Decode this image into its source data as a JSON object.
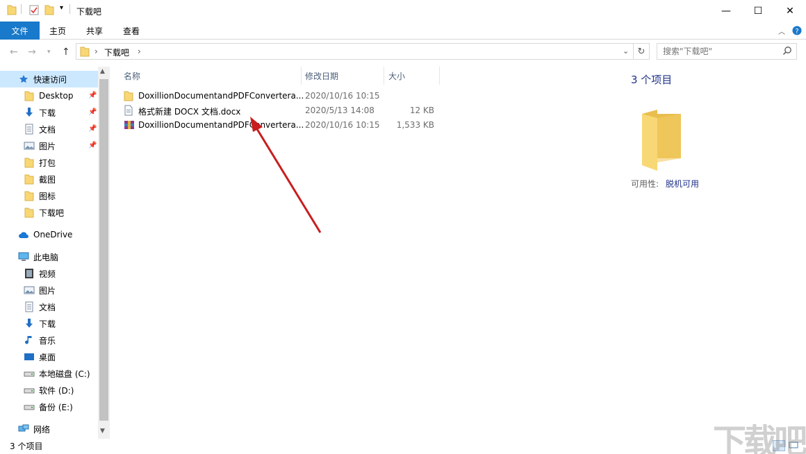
{
  "window": {
    "title": "下载吧",
    "minimize": "—",
    "maximize": "☐",
    "close": "✕"
  },
  "ribbon": {
    "tabs": [
      "文件",
      "主页",
      "共享",
      "查看"
    ]
  },
  "address": {
    "crumbs": [
      "下载吧"
    ],
    "search_placeholder": "搜索\"下载吧\""
  },
  "nav": {
    "quick_access": "快速访问",
    "quick_items": [
      {
        "label": "Desktop",
        "icon": "folder-icon",
        "pinned": true
      },
      {
        "label": "下载",
        "icon": "download-icon",
        "pinned": true
      },
      {
        "label": "文档",
        "icon": "document-icon",
        "pinned": true
      },
      {
        "label": "图片",
        "icon": "picture-icon",
        "pinned": true
      },
      {
        "label": "打包",
        "icon": "folder-icon",
        "pinned": false
      },
      {
        "label": "截图",
        "icon": "folder-icon",
        "pinned": false
      },
      {
        "label": "图标",
        "icon": "folder-icon",
        "pinned": false
      },
      {
        "label": "下载吧",
        "icon": "folder-icon",
        "pinned": false
      }
    ],
    "onedrive": "OneDrive",
    "this_pc": "此电脑",
    "pc_items": [
      {
        "label": "视频",
        "icon": "video-icon"
      },
      {
        "label": "图片",
        "icon": "picture-icon"
      },
      {
        "label": "文档",
        "icon": "document-icon"
      },
      {
        "label": "下载",
        "icon": "download-icon"
      },
      {
        "label": "音乐",
        "icon": "music-icon"
      },
      {
        "label": "桌面",
        "icon": "desktop-icon"
      },
      {
        "label": "本地磁盘 (C:)",
        "icon": "drive-icon"
      },
      {
        "label": "软件 (D:)",
        "icon": "drive-icon"
      },
      {
        "label": "备份 (E:)",
        "icon": "drive-icon"
      }
    ],
    "network": "网络"
  },
  "columns": {
    "name": "名称",
    "date": "修改日期",
    "size": "大小"
  },
  "files": [
    {
      "name": "DoxillionDocumentandPDFConvertera...",
      "date": "2020/10/16 10:15",
      "size": "",
      "icon": "folder-icon"
    },
    {
      "name": "格式新建 DOCX 文档.docx",
      "date": "2020/5/13 14:08",
      "size": "12 KB",
      "icon": "docx-file-icon"
    },
    {
      "name": "DoxillionDocumentandPDFConvertera...",
      "date": "2020/10/16 10:15",
      "size": "1,533 KB",
      "icon": "archive-icon"
    }
  ],
  "details": {
    "title": "3 个项目",
    "avail_label": "可用性:",
    "avail_value": "脱机可用"
  },
  "status": {
    "count": "3 个项目"
  },
  "watermark": "下载吧",
  "colors": {
    "accent": "#1979ca",
    "arrow": "#d01f1f",
    "folder": "#f8d775"
  }
}
